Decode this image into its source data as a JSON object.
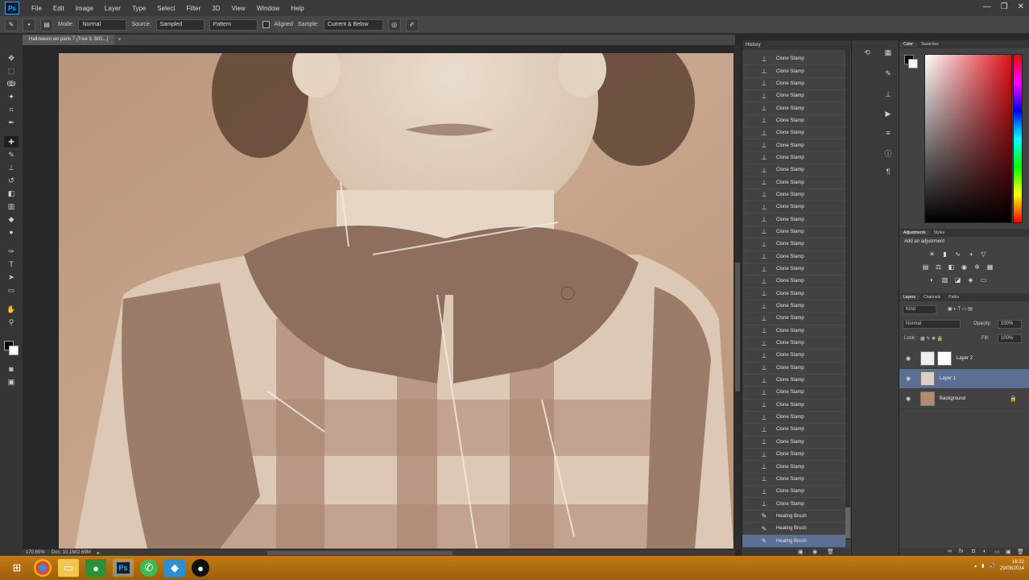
{
  "app": {
    "logo": "Ps",
    "menu": [
      "File",
      "Edit",
      "Image",
      "Layer",
      "Type",
      "Select",
      "Filter",
      "3D",
      "View",
      "Window",
      "Help"
    ],
    "window_controls": [
      "—",
      "❐",
      "✕"
    ]
  },
  "options_bar": {
    "mode_label": "Mode:",
    "mode_value": "Normal",
    "source_label": "Source:",
    "sampled_value": "Sampled",
    "pattern_value": "Pattern",
    "aligned_label": "Aligned",
    "sample_label": "Sample:",
    "sample_value": "Current & Below"
  },
  "document": {
    "tab_title": "Halloween wo paris 7 (Tree 3, B/G...)",
    "zoom": "170.85%",
    "doc_info": "Doc: 10.1M/2.69M"
  },
  "history": {
    "panel_title": "History",
    "items": [
      {
        "label": "Clone Stamp",
        "icon": "clone-stamp-icon"
      },
      {
        "label": "Clone Stamp",
        "icon": "clone-stamp-icon"
      },
      {
        "label": "Clone Stamp",
        "icon": "clone-stamp-icon"
      },
      {
        "label": "Clone Stamp",
        "icon": "clone-stamp-icon"
      },
      {
        "label": "Clone Stamp",
        "icon": "clone-stamp-icon"
      },
      {
        "label": "Clone Stamp",
        "icon": "clone-stamp-icon"
      },
      {
        "label": "Clone Stamp",
        "icon": "clone-stamp-icon"
      },
      {
        "label": "Clone Stamp",
        "icon": "clone-stamp-icon"
      },
      {
        "label": "Clone Stamp",
        "icon": "clone-stamp-icon"
      },
      {
        "label": "Clone Stamp",
        "icon": "clone-stamp-icon"
      },
      {
        "label": "Clone Stamp",
        "icon": "clone-stamp-icon"
      },
      {
        "label": "Clone Stamp",
        "icon": "clone-stamp-icon"
      },
      {
        "label": "Clone Stamp",
        "icon": "clone-stamp-icon"
      },
      {
        "label": "Clone Stamp",
        "icon": "clone-stamp-icon"
      },
      {
        "label": "Clone Stamp",
        "icon": "clone-stamp-icon"
      },
      {
        "label": "Clone Stamp",
        "icon": "clone-stamp-icon"
      },
      {
        "label": "Clone Stamp",
        "icon": "clone-stamp-icon"
      },
      {
        "label": "Clone Stamp",
        "icon": "clone-stamp-icon"
      },
      {
        "label": "Clone Stamp",
        "icon": "clone-stamp-icon"
      },
      {
        "label": "Clone Stamp",
        "icon": "clone-stamp-icon"
      },
      {
        "label": "Clone Stamp",
        "icon": "clone-stamp-icon"
      },
      {
        "label": "Clone Stamp",
        "icon": "clone-stamp-icon"
      },
      {
        "label": "Clone Stamp",
        "icon": "clone-stamp-icon"
      },
      {
        "label": "Clone Stamp",
        "icon": "clone-stamp-icon"
      },
      {
        "label": "Clone Stamp",
        "icon": "clone-stamp-icon"
      },
      {
        "label": "Clone Stamp",
        "icon": "clone-stamp-icon"
      },
      {
        "label": "Clone Stamp",
        "icon": "clone-stamp-icon"
      },
      {
        "label": "Clone Stamp",
        "icon": "clone-stamp-icon"
      },
      {
        "label": "Clone Stamp",
        "icon": "clone-stamp-icon"
      },
      {
        "label": "Clone Stamp",
        "icon": "clone-stamp-icon"
      },
      {
        "label": "Clone Stamp",
        "icon": "clone-stamp-icon"
      },
      {
        "label": "Clone Stamp",
        "icon": "clone-stamp-icon"
      },
      {
        "label": "Clone Stamp",
        "icon": "clone-stamp-icon"
      },
      {
        "label": "Clone Stamp",
        "icon": "clone-stamp-icon"
      },
      {
        "label": "Clone Stamp",
        "icon": "clone-stamp-icon"
      },
      {
        "label": "Clone Stamp",
        "icon": "clone-stamp-icon"
      },
      {
        "label": "Clone Stamp",
        "icon": "clone-stamp-icon"
      },
      {
        "label": "Healing Brush",
        "icon": "healing-brush-icon"
      },
      {
        "label": "Healing Brush",
        "icon": "healing-brush-icon"
      },
      {
        "label": "Healing Brush",
        "icon": "healing-brush-icon"
      }
    ],
    "selected_index": 39
  },
  "color_panel": {
    "tabs": [
      "Color",
      "Swatches"
    ],
    "foreground": "#000000",
    "background": "#ffffff"
  },
  "adjustments_panel": {
    "tabs": [
      "Adjustments",
      "Styles"
    ],
    "title": "Add an adjustment"
  },
  "layers_panel": {
    "tabs": [
      "Layers",
      "Channels",
      "Paths"
    ],
    "kind_filter": "Kind",
    "blend_mode": "Normal",
    "opacity_label": "Opacity:",
    "opacity_value": "100%",
    "lock_label": "Lock:",
    "fill_label": "Fill:",
    "fill_value": "100%",
    "layers": [
      {
        "name": "Layer 2",
        "selected": false,
        "has_mask": true
      },
      {
        "name": "Layer 1",
        "selected": true,
        "has_mask": false
      },
      {
        "name": "Background",
        "selected": false,
        "has_mask": false,
        "locked": true
      }
    ]
  },
  "taskbar": {
    "apps": [
      "start-icon",
      "chrome-icon",
      "explorer-icon",
      "app-green-icon",
      "photoshop-icon",
      "app-whatsapp-icon",
      "app-blue-icon",
      "app-dark-icon"
    ],
    "time": "16:22",
    "date": "29/08/2014"
  },
  "colors": {
    "selection": "#5b6f93",
    "taskbar": "#b06e12",
    "photo_tone": "#c9a98f"
  }
}
